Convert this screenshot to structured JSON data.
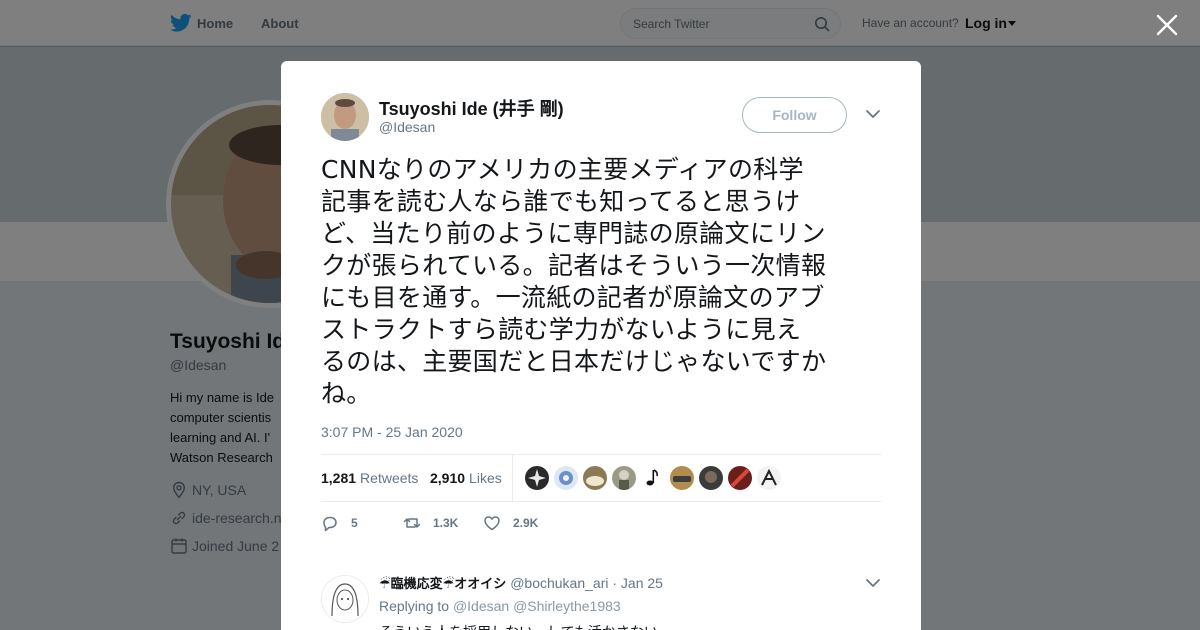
{
  "nav": {
    "home_label": "Home",
    "about_label": "About",
    "search_placeholder": "Search Twitter",
    "account_prompt": "Have an account?",
    "login_label": "Log in",
    "brand_color": "#1da1f2"
  },
  "profile": {
    "name": "Tsuyoshi Ide",
    "handle": "@Idesan",
    "bio_lines": [
      "Hi my name is Ide",
      "computer scientis",
      "learning and AI. I'",
      "Watson Research"
    ],
    "location": "NY, USA",
    "website": "ide-research.n",
    "joined": "Joined June 2"
  },
  "tweet": {
    "author_name": "Tsuyoshi Ide (井手 剛)",
    "author_handle": "@Idesan",
    "follow_label": "Follow",
    "text_lines": [
      "CNNなりのアメリカの主要メディアの科学",
      "記事を読む人なら誰でも知ってると思うけ",
      "ど、当たり前のように専門誌の原論文にリン",
      "クが張られている。記者はそういう一次情報",
      "にも目を通す。一流紙の記者が原論文のアブ",
      "ストラクトすら読む学力がないように見え",
      "るのは、主要国だと日本だけじゃないですか",
      "ね。"
    ],
    "timestamp": "3:07 PM - 25 Jan 2020",
    "retweets_count": "1,281",
    "retweets_label": "Retweets",
    "likes_count": "2,910",
    "likes_label": "Likes",
    "reply_count": "5",
    "retweet_action_count": "1.3K",
    "like_action_count": "2.9K"
  },
  "reply": {
    "name": "☔臨機応変☔オオイシ",
    "handle": "@bochukan_ari",
    "date": "· Jan 25",
    "replying_to_label": "Replying to",
    "replying_to_1": "@Idesan",
    "replying_to_2": "@Shirleythe1983",
    "text": "そういう人を採用しない、しても活かさない"
  }
}
